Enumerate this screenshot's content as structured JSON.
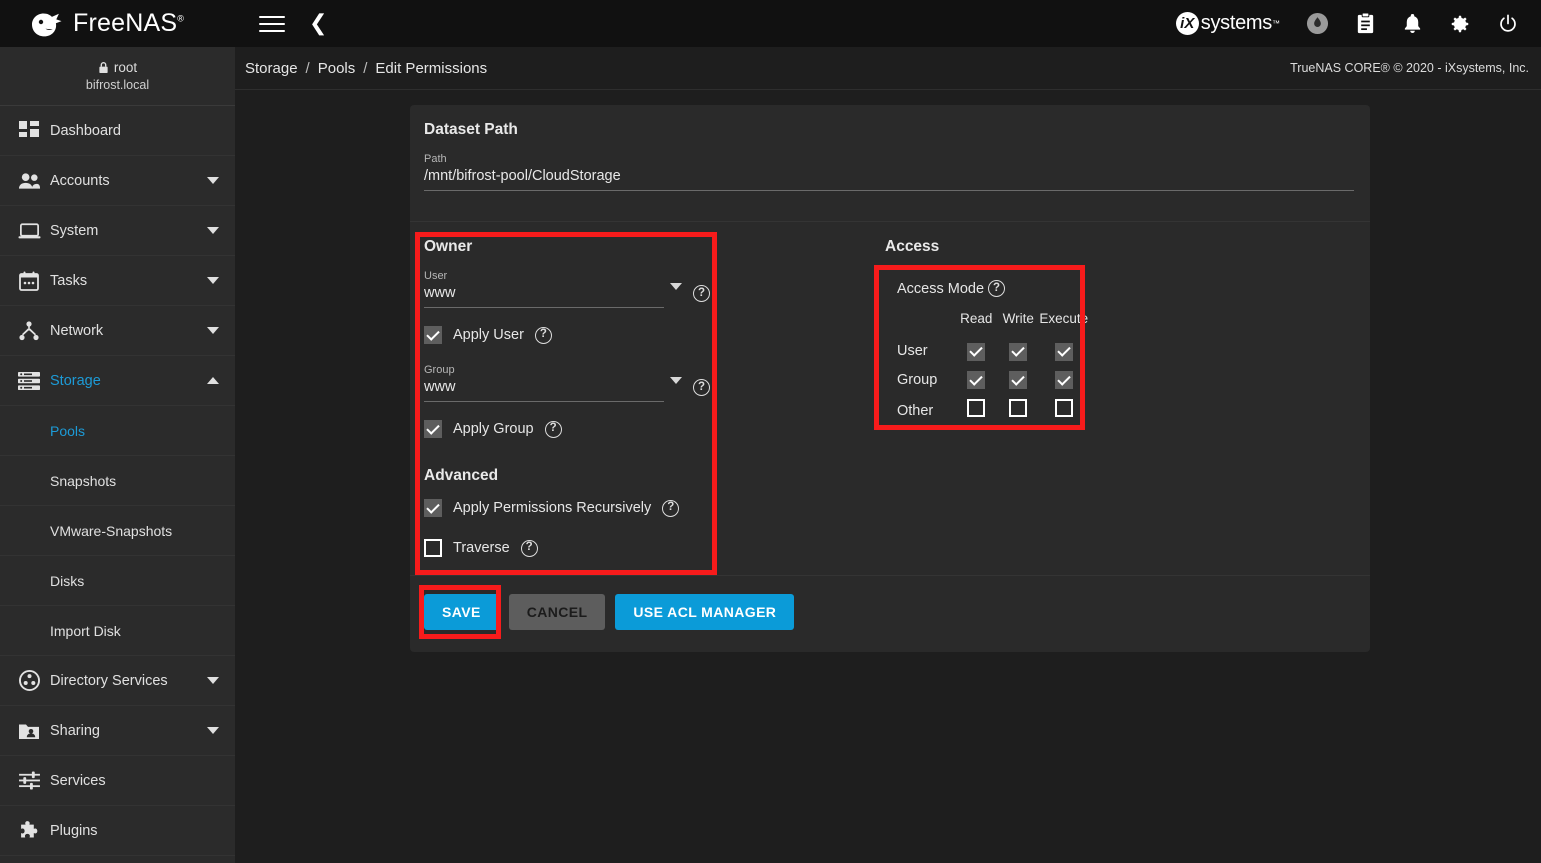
{
  "app": {
    "brand_name": "FreeNAS",
    "brand_tm": "®",
    "vendor_name": "systems",
    "vendor_initial": "iX",
    "vendor_tm": "™"
  },
  "header": {
    "menu_icon": "hamburger-menu-icon",
    "back_icon": "chevron-left-icon",
    "icons": [
      {
        "name": "dark-mode-icon",
        "glyph": "◕"
      },
      {
        "name": "task-manager-icon",
        "glyph": "📋"
      },
      {
        "name": "alerts-bell-icon",
        "glyph": "🔔"
      },
      {
        "name": "settings-gear-icon",
        "glyph": "⚙"
      },
      {
        "name": "power-icon",
        "glyph": "⏻"
      }
    ]
  },
  "sidebar": {
    "user": {
      "name": "root",
      "host": "bifrost.local",
      "lock_icon": "lock-icon"
    },
    "items": [
      {
        "label": "Dashboard",
        "icon": "dashboard-icon",
        "expandable": false,
        "active": false,
        "sub": false
      },
      {
        "label": "Accounts",
        "icon": "accounts-people-icon",
        "expandable": true,
        "active": false,
        "sub": false
      },
      {
        "label": "System",
        "icon": "system-laptop-icon",
        "expandable": true,
        "active": false,
        "sub": false
      },
      {
        "label": "Tasks",
        "icon": "tasks-calendar-icon",
        "expandable": true,
        "active": false,
        "sub": false
      },
      {
        "label": "Network",
        "icon": "network-icon",
        "expandable": true,
        "active": false,
        "sub": false
      },
      {
        "label": "Storage",
        "icon": "storage-icon",
        "expandable": true,
        "expanded": true,
        "active": true,
        "sub": false
      },
      {
        "label": "Pools",
        "icon": "",
        "expandable": false,
        "active": true,
        "sub": true
      },
      {
        "label": "Snapshots",
        "icon": "",
        "expandable": false,
        "active": false,
        "sub": true
      },
      {
        "label": "VMware-Snapshots",
        "icon": "",
        "expandable": false,
        "active": false,
        "sub": true
      },
      {
        "label": "Disks",
        "icon": "",
        "expandable": false,
        "active": false,
        "sub": true
      },
      {
        "label": "Import Disk",
        "icon": "",
        "expandable": false,
        "active": false,
        "sub": true
      },
      {
        "label": "Directory Services",
        "icon": "directory-services-icon",
        "expandable": true,
        "active": false,
        "sub": false
      },
      {
        "label": "Sharing",
        "icon": "sharing-folder-icon",
        "expandable": true,
        "active": false,
        "sub": false
      },
      {
        "label": "Services",
        "icon": "services-sliders-icon",
        "expandable": false,
        "active": false,
        "sub": false
      },
      {
        "label": "Plugins",
        "icon": "plugins-puzzle-icon",
        "expandable": false,
        "active": false,
        "sub": false
      }
    ]
  },
  "breadcrumb": {
    "items": [
      "Storage",
      "Pools",
      "Edit Permissions"
    ],
    "separator": "/"
  },
  "copyright": "TrueNAS CORE® © 2020 - iXsystems, Inc.",
  "form": {
    "dataset_path": {
      "section_title": "Dataset Path",
      "path_label": "Path",
      "path_value": "/mnt/bifrost-pool/CloudStorage"
    },
    "owner": {
      "section_title": "Owner",
      "user_label": "User",
      "user_value": "www",
      "apply_user_label": "Apply User",
      "apply_user_checked": true,
      "group_label": "Group",
      "group_value": "www",
      "apply_group_label": "Apply Group",
      "apply_group_checked": true,
      "help_glyph": "?"
    },
    "advanced": {
      "section_title": "Advanced",
      "recursive_label": "Apply Permissions Recursively",
      "recursive_checked": true,
      "traverse_label": "Traverse",
      "traverse_checked": false
    },
    "access": {
      "section_title": "Access",
      "mode_label": "Access Mode",
      "columns": [
        "Read",
        "Write",
        "Execute"
      ],
      "rows": [
        {
          "label": "User",
          "read": true,
          "write": true,
          "execute": true
        },
        {
          "label": "Group",
          "read": true,
          "write": true,
          "execute": true
        },
        {
          "label": "Other",
          "read": false,
          "write": false,
          "execute": false
        }
      ]
    },
    "buttons": {
      "save": "SAVE",
      "cancel": "CANCEL",
      "acl_manager": "USE ACL MANAGER"
    }
  },
  "colors": {
    "accent_blue": "#0b9bd8",
    "highlight_red": "#f71b1b",
    "card_bg": "#2a2a2a",
    "page_bg": "#1e1e1e",
    "sidebar_bg": "#2b2b2b",
    "topbar_bg": "#111111"
  },
  "highlights": [
    {
      "name": "owner-section-highlight"
    },
    {
      "name": "access-mode-highlight"
    },
    {
      "name": "save-button-highlight"
    }
  ]
}
